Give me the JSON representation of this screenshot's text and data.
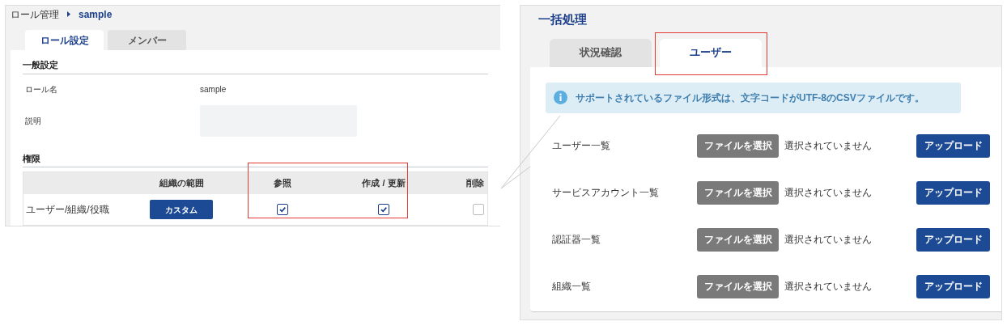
{
  "left": {
    "breadcrumb": {
      "parent": "ロール管理",
      "current": "sample"
    },
    "tabs": [
      {
        "label": "ロール設定",
        "selected": true
      },
      {
        "label": "メンバー",
        "selected": false
      }
    ],
    "general": {
      "heading": "一般設定",
      "fields": [
        {
          "kind": "text",
          "label": "ロール名",
          "value": "sample"
        },
        {
          "kind": "textarea",
          "label": "説明"
        }
      ]
    },
    "permissions": {
      "heading": "権限",
      "columns": [
        "組織の範囲",
        "参照",
        "作成 / 更新",
        "削除"
      ],
      "rows": [
        {
          "label": "ユーザー/組織/役職",
          "scope_button": "カスタム",
          "read": true,
          "write": true,
          "delete": false
        }
      ]
    }
  },
  "right": {
    "title": "一括処理",
    "tabs": [
      {
        "label": "状況確認",
        "selected": false
      },
      {
        "label": "ユーザー",
        "selected": true
      }
    ],
    "info": "サポートされているファイル形式は、文字コードがUTF-8のCSVファイルです。",
    "rows": [
      {
        "label": "ユーザー一覧",
        "file_button": "ファイルを選択",
        "file_status": "選択されていません",
        "upload_button": "アップロード"
      },
      {
        "label": "サービスアカウント一覧",
        "file_button": "ファイルを選択",
        "file_status": "選択されていません",
        "upload_button": "アップロード"
      },
      {
        "label": "認証器一覧",
        "file_button": "ファイルを選択",
        "file_status": "選択されていません",
        "upload_button": "アップロード"
      },
      {
        "label": "組織一覧",
        "file_button": "ファイルを選択",
        "file_status": "選択されていません",
        "upload_button": "アップロード"
      }
    ]
  }
}
